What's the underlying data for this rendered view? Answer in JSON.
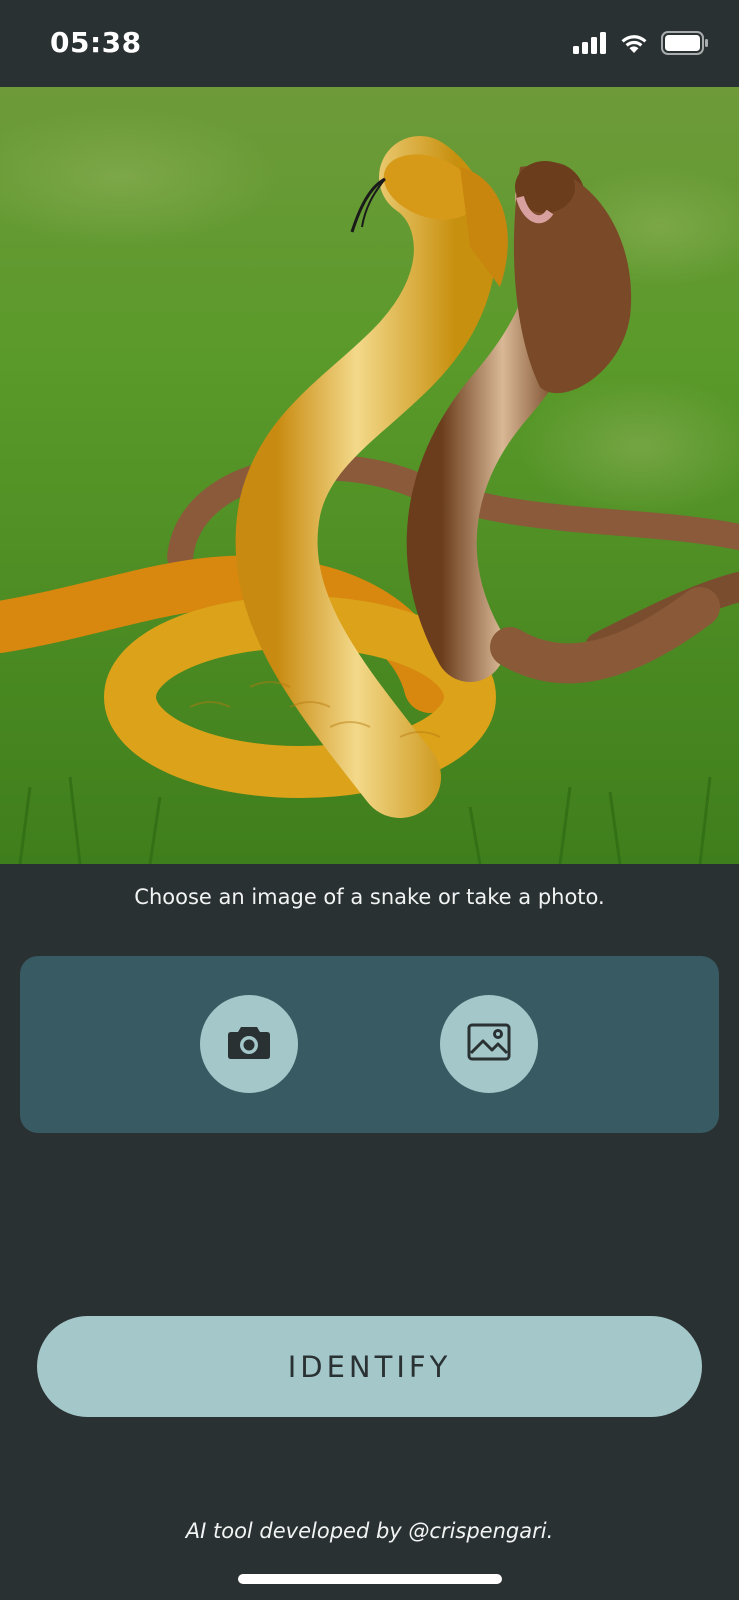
{
  "status_bar": {
    "time": "05:38",
    "icons": [
      "signal-icon",
      "wifi-icon",
      "battery-icon"
    ]
  },
  "hero": {
    "image": "snake-photo"
  },
  "prompt_text": "Choose an image of a snake or take a photo.",
  "picker": {
    "camera_icon": "camera-icon",
    "gallery_icon": "image-icon"
  },
  "identify_label": "IDENTIFY",
  "footer": "AI tool developed by @crispengari.",
  "colors": {
    "background": "#2a3133",
    "panel": "#385a63",
    "accent": "#a4c7ca",
    "text": "#ffffff"
  }
}
